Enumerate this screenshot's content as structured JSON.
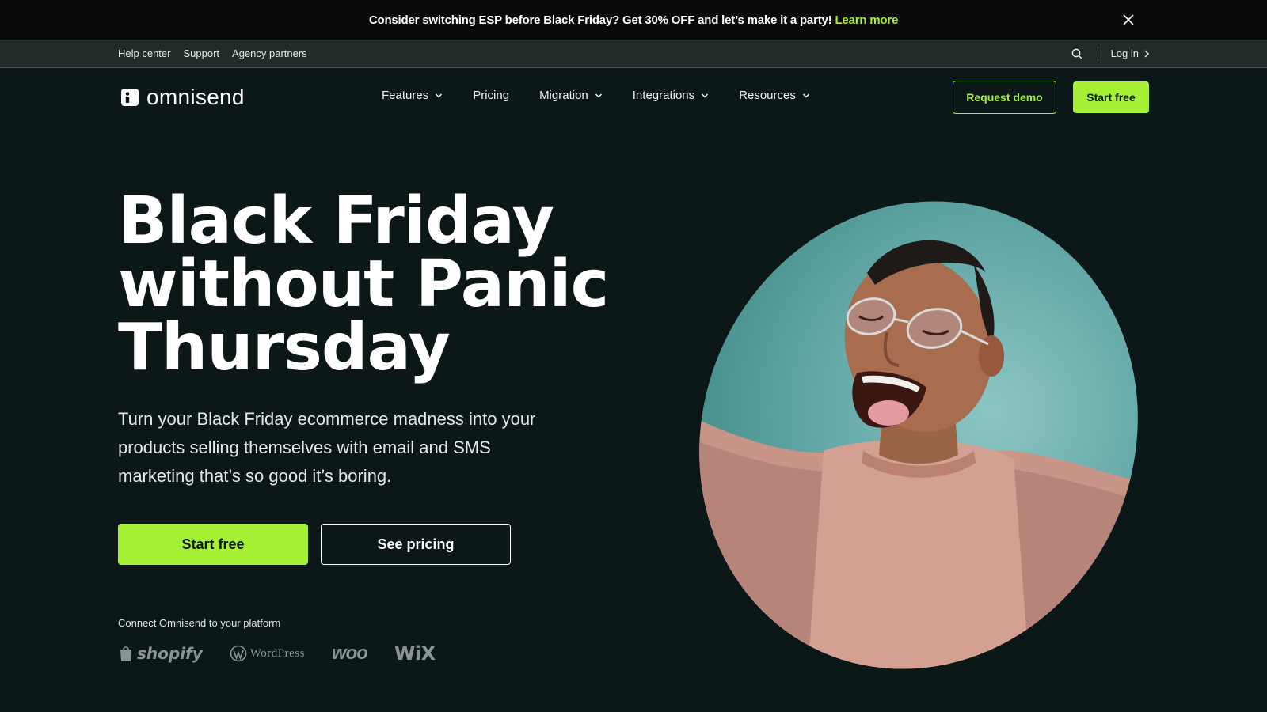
{
  "announcement": {
    "text": "Consider switching ESP before Black Friday? Get 30% OFF and let’s make it a party!",
    "link": "Learn more",
    "close_icon": "close-icon"
  },
  "utility": {
    "links": [
      "Help center",
      "Support",
      "Agency partners"
    ],
    "login": "Log in",
    "search_icon": "search-icon"
  },
  "nav": {
    "logo_text": "omnisend",
    "items": [
      {
        "label": "Features",
        "dropdown": true
      },
      {
        "label": "Pricing",
        "dropdown": false
      },
      {
        "label": "Migration",
        "dropdown": true
      },
      {
        "label": "Integrations",
        "dropdown": true
      },
      {
        "label": "Resources",
        "dropdown": true
      }
    ],
    "request_demo": "Request demo",
    "start_free": "Start free"
  },
  "hero": {
    "title_lines": [
      "Black Friday",
      "without Panic",
      "Thursday"
    ],
    "subtitle": "Turn your Black Friday ecommerce madness into your products selling themselves with email and SMS marketing that’s so good it’s boring.",
    "cta_primary": "Start free",
    "cta_secondary": "See pricing",
    "platform_label": "Connect Omnisend to your platform",
    "platforms": [
      "shopify",
      "WordPress",
      "woo",
      "WiX"
    ]
  },
  "colors": {
    "background": "#0b1817",
    "accent": "#a6f135",
    "announcement_bg": "#0a0a0a",
    "utility_bg": "#232b2a"
  }
}
